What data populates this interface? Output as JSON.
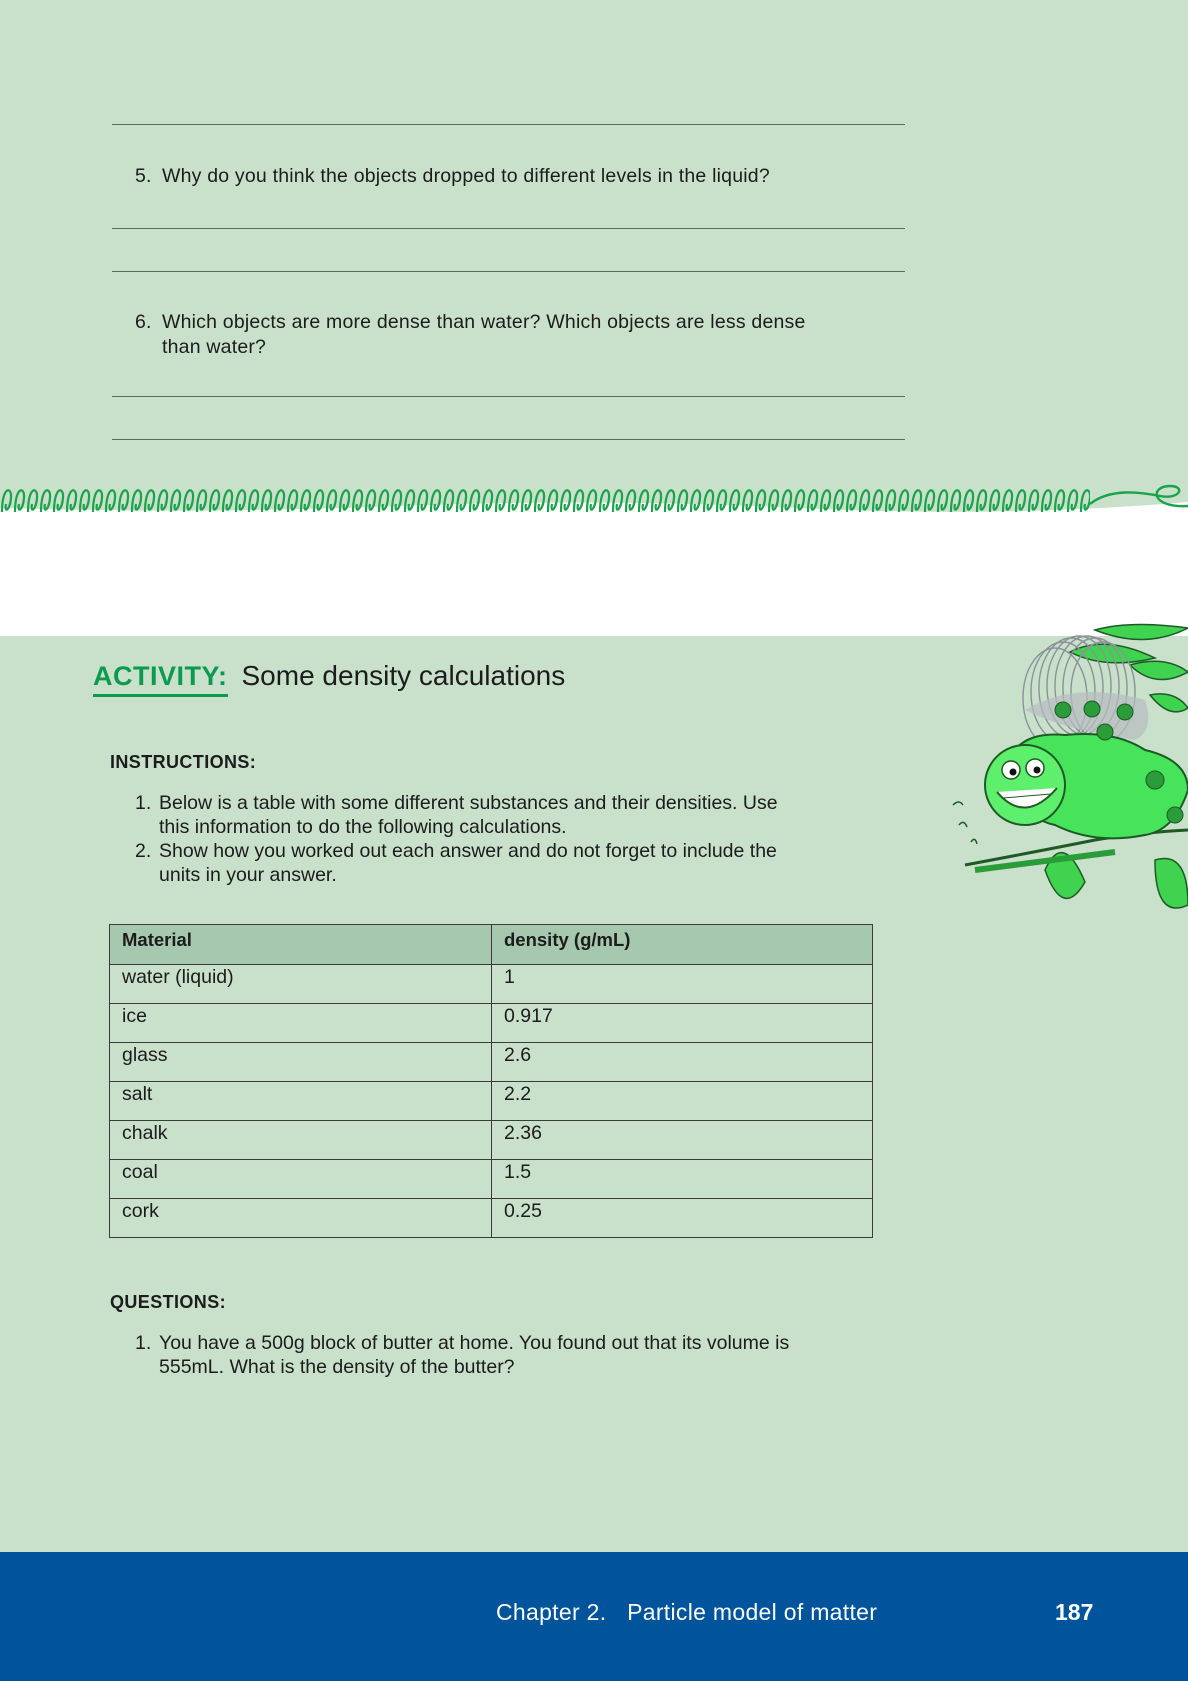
{
  "questions_top": [
    {
      "number": "5.",
      "text": "Why do you think the objects dropped to different levels in the liquid?"
    },
    {
      "number": "6.",
      "text_line1": "Which objects are more dense than water? Which objects are less dense",
      "text_line2": "than water?"
    }
  ],
  "activity": {
    "label": "ACTIVITY:",
    "title": "Some density calculations"
  },
  "instructions": {
    "heading": "INSTRUCTIONS:",
    "items": [
      {
        "number": "1.",
        "line1": "Below is a table with some different substances and their densities. Use",
        "line2": "this information to do the following calculations."
      },
      {
        "number": "2.",
        "line1": "Show how you worked out each answer and do not forget to include the",
        "line2": "units in your answer."
      }
    ]
  },
  "table": {
    "headers": [
      "Material",
      "density (g/mL)"
    ],
    "rows": [
      [
        "water (liquid)",
        "1"
      ],
      [
        "ice",
        "0.917"
      ],
      [
        "glass",
        "2.6"
      ],
      [
        "salt",
        "2.2"
      ],
      [
        "chalk",
        "2.36"
      ],
      [
        "coal",
        "1.5"
      ],
      [
        "cork",
        "0.25"
      ]
    ]
  },
  "questions": {
    "heading": "QUESTIONS:",
    "items": [
      {
        "number": "1.",
        "line1": "You have a 500g block of butter at home. You found out that its volume is",
        "line2": "555mL. What is the density of the butter?"
      }
    ]
  },
  "footer": {
    "chapter": "Chapter 2.",
    "chapter_title": "Particle model of matter",
    "page": "187"
  },
  "colors": {
    "page_bg": "#c9e0cb",
    "activity_green": "#0b9a4f",
    "table_header_bg": "#a6c8ae",
    "footer_blue": "#00549c"
  },
  "icons": {
    "divider": "spring-divider-icon",
    "mascot": "slinky-mascot-icon"
  }
}
